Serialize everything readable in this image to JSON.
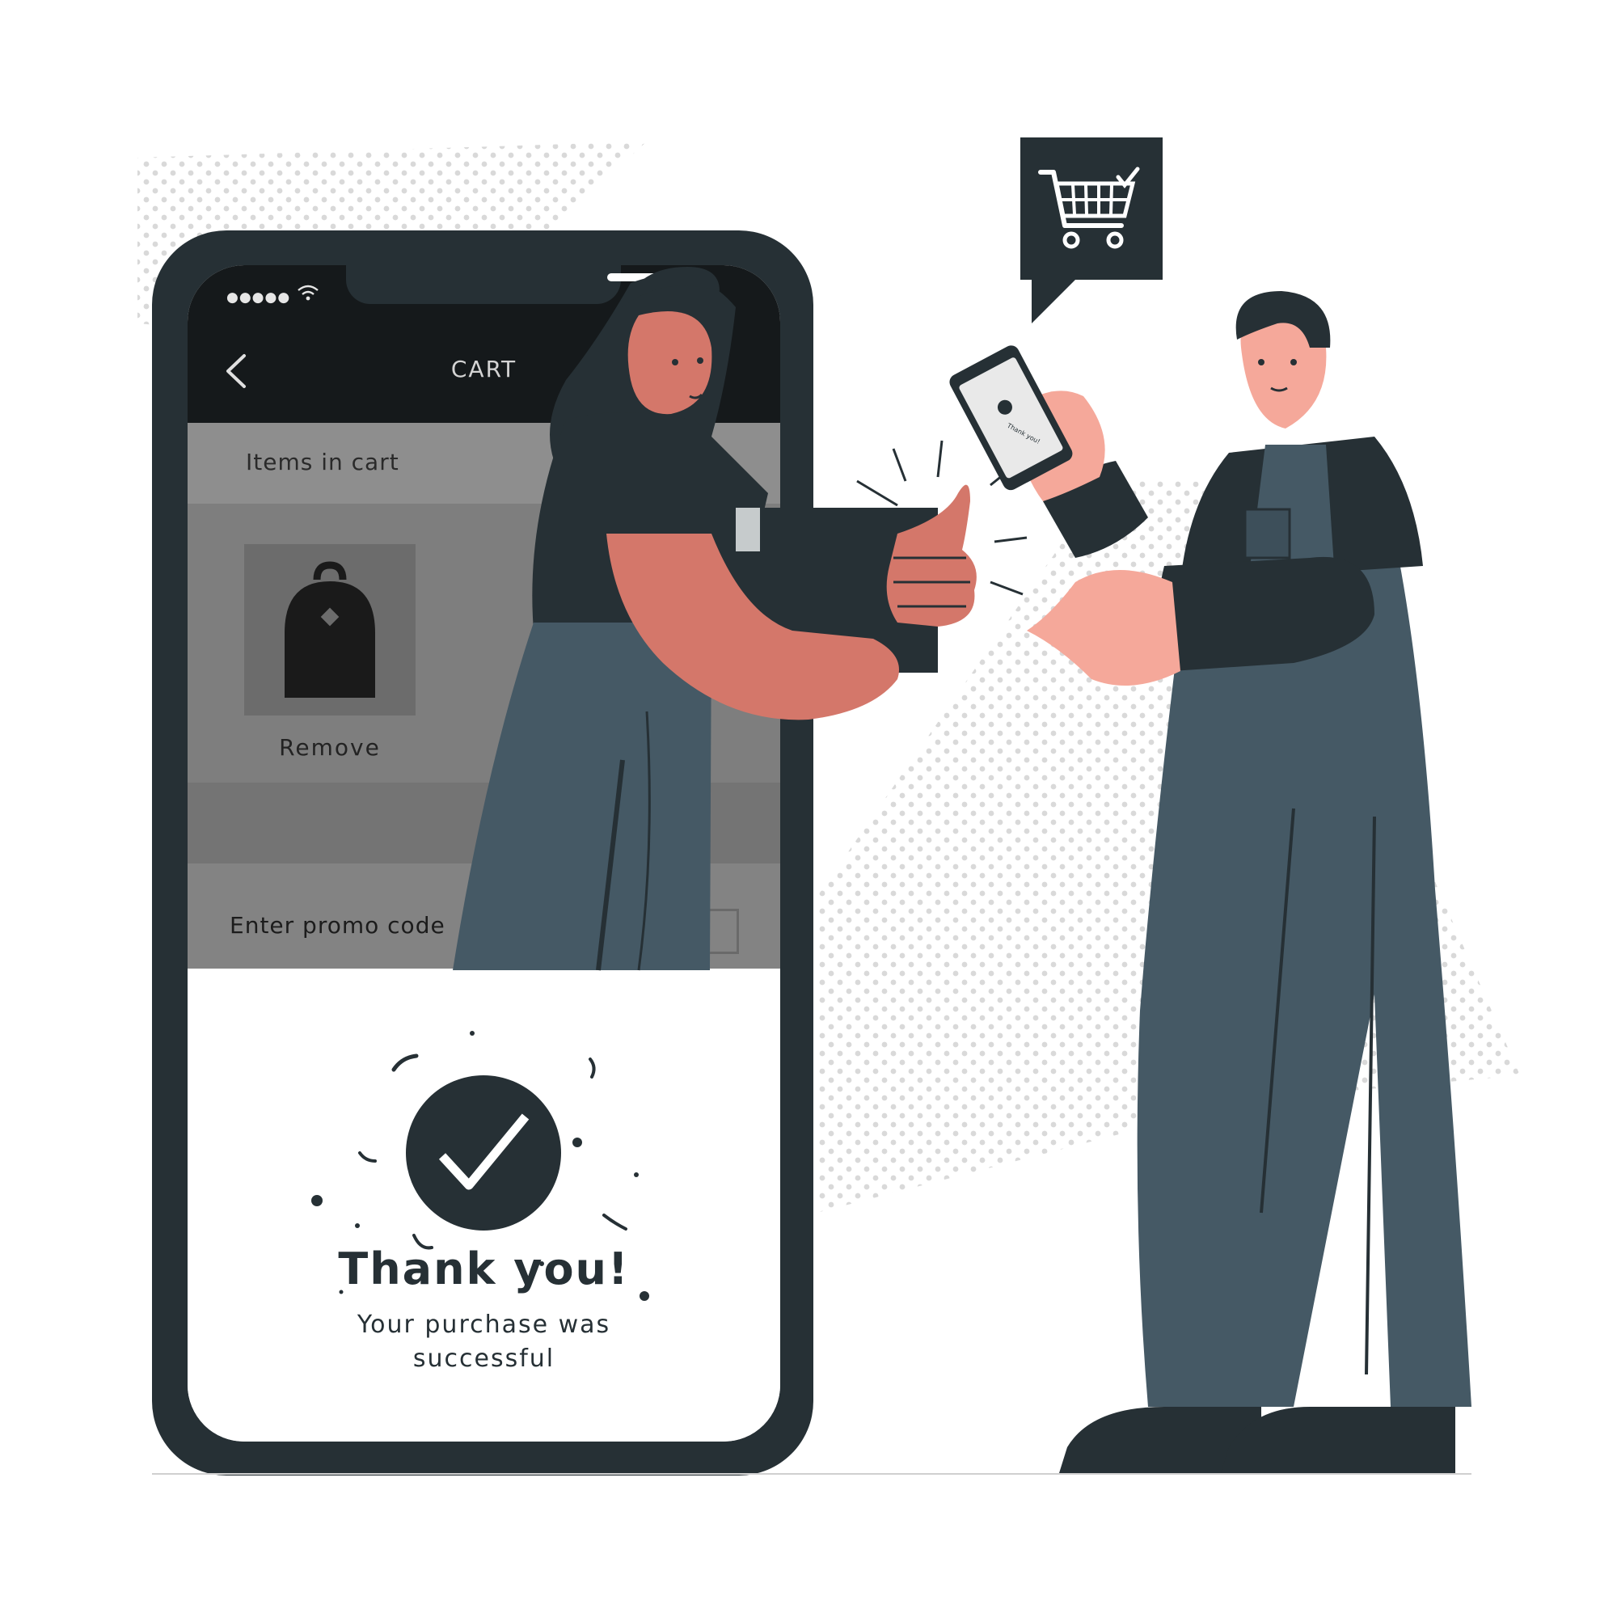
{
  "colors": {
    "dark": "#263035",
    "screen_top": "#15191b",
    "skin_woman": "#d4776a",
    "skin_man": "#f5a89a",
    "pants": "#455965",
    "dots": "#d7d7d7"
  },
  "phone": {
    "status": {
      "signal_icon": "signal-dots",
      "wifi_icon": "wifi-icon",
      "signal_text": "●●●●●"
    },
    "header": {
      "back_icon": "chevron-left-icon",
      "title": "CART"
    },
    "items_header": "Items in cart",
    "item": {
      "thumbnail_icon": "backpack-icon",
      "remove_label": "Remove"
    },
    "promo": {
      "label": "Enter promo code"
    },
    "success": {
      "icon": "check-circle-icon",
      "title": "Thank you!",
      "subtitle": "Your purchase was successful"
    }
  },
  "speech_bubble": {
    "icon": "shopping-cart-check-icon"
  },
  "mini_phone": {
    "text": "Thank you!"
  }
}
